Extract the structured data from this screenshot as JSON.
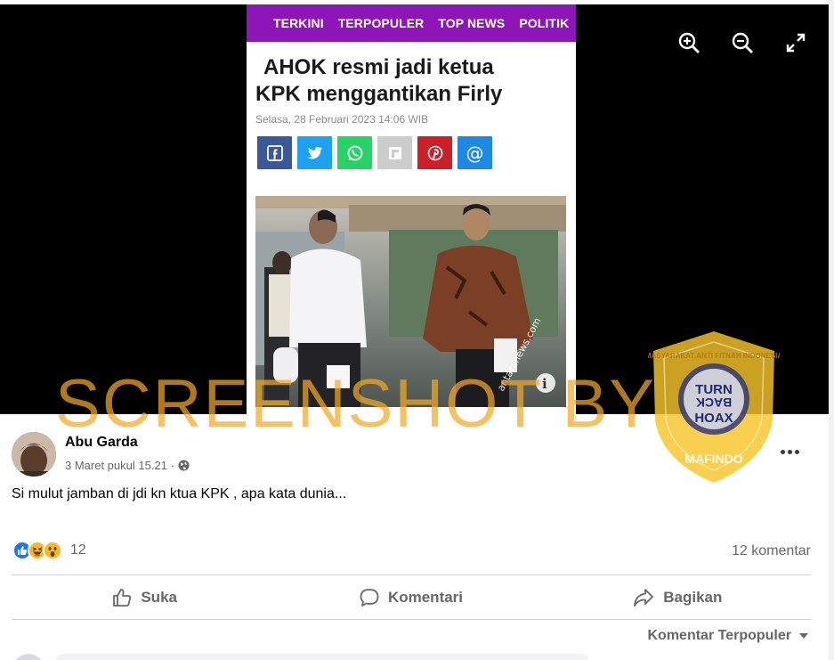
{
  "viewer": {
    "controls": [
      "zoom-in-icon",
      "zoom-out-icon",
      "fullscreen-icon"
    ]
  },
  "article": {
    "nav": [
      "TERKINI",
      "TERPOPULER",
      "TOP NEWS",
      "POLITIK"
    ],
    "title_line1": "AHOK resmi jadi ketua",
    "title_line2": "KPK menggantikan Firly",
    "date": "Selasa, 28 Februari 2023 14:06 WIB",
    "share_buttons": [
      {
        "icon": "facebook-icon",
        "color": "#3b5998"
      },
      {
        "icon": "twitter-icon",
        "color": "#1da1f2"
      },
      {
        "icon": "whatsapp-icon",
        "color": "#25d366"
      },
      {
        "icon": "flipboard-icon",
        "color": "#cccccc"
      },
      {
        "icon": "pinterest-icon",
        "color": "#cb2027"
      },
      {
        "icon": "email-icon",
        "color": "#1e88e5"
      }
    ],
    "photo_credit": "antaranews.com"
  },
  "watermark": {
    "text": "SCREENSHOT BY",
    "badge_top_text": "MASYARAKAT ANTI FITNAH INDONESIA",
    "badge_center": "TURN BACK HOAX",
    "badge_bottom": "MAFINDO",
    "color": "#f4a822"
  },
  "post": {
    "author": "Abu Garda",
    "timestamp": "3 Maret pukul 15.21",
    "separator": "·",
    "text": "Si mulut jamban di jdi kn ktua KPK , apa kata dunia...",
    "reaction_count": "12",
    "comment_count": "12 komentar",
    "reactions": [
      "like-icon",
      "haha-icon",
      "wow-icon"
    ]
  },
  "actions": {
    "like": "Suka",
    "comment": "Komentari",
    "share": "Bagikan"
  },
  "comments": {
    "sort_label": "Komentar Terpopuler"
  }
}
